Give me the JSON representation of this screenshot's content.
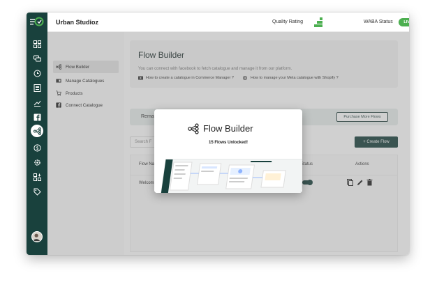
{
  "app": {
    "brand": "Urban Studioz"
  },
  "header": {
    "quality_rating_label": "Quality Rating",
    "waba_status_label": "WABA Status",
    "waba_status_value": "LIVE",
    "live_color": "#4caf50"
  },
  "rail": {
    "color": "#19413d",
    "icons": [
      "grid-icon",
      "chat-icon",
      "history-icon",
      "template-icon",
      "broadcast-icon",
      "facebook-icon",
      "flow-icon",
      "payment-icon",
      "settings-icon",
      "apps-icon",
      "tag-icon"
    ],
    "active": "flow-icon"
  },
  "sidebar": {
    "items": [
      {
        "label": "Flow Builder",
        "icon": "flow-icon",
        "active": true
      },
      {
        "label": "Manage Catalogues",
        "icon": "catalogue-icon",
        "active": false
      },
      {
        "label": "Products",
        "icon": "cart-icon",
        "active": false
      },
      {
        "label": "Connect Catalogue",
        "icon": "facebook-icon",
        "active": false
      }
    ]
  },
  "main": {
    "title": "Flow Builder",
    "description": "You can connect with facebook to fetch catalogue and manage it from our platform.",
    "link1": "How to create a catalogue in Commerce Manager ?",
    "link2": "How to manage your Meta catalogue with Shopify ?",
    "quota": "Remaining Quota : 11/15",
    "purchase_button": "Purchase More Flows",
    "search_placeholder": "Search F",
    "create_button": "+ Create Flow",
    "table": {
      "headers": [
        "Flow Na",
        "Status",
        "Actions"
      ],
      "rows": [
        {
          "name": "Welcom",
          "status_on": true
        }
      ]
    }
  },
  "modal": {
    "title": "Flow Builder",
    "subtitle": "15 Flows Unlocked!"
  }
}
